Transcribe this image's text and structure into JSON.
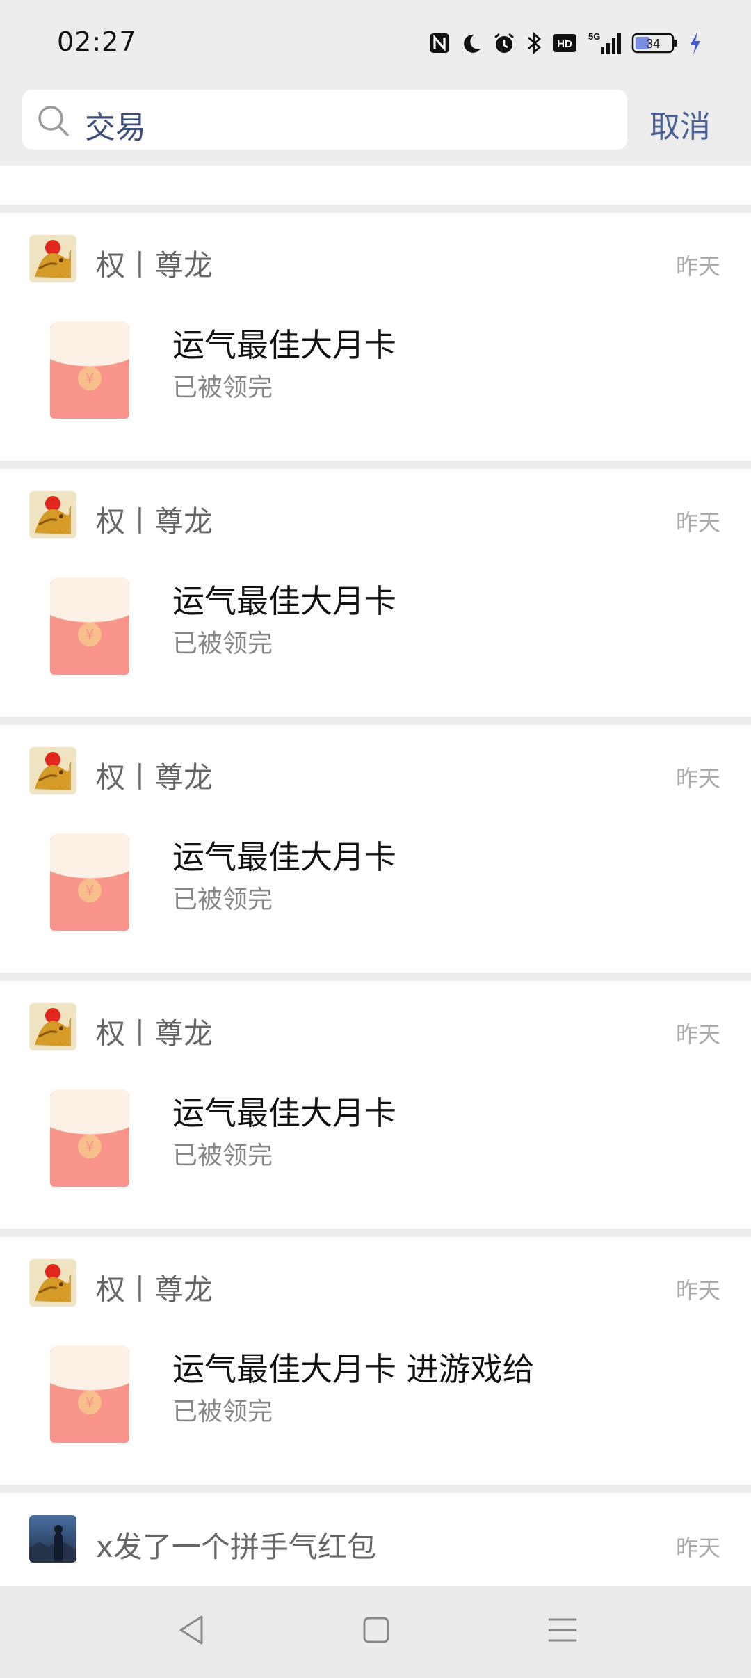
{
  "status": {
    "time": "02:27",
    "battery": "34",
    "icons": [
      "nfc-icon",
      "moon-icon",
      "alarm-icon",
      "bluetooth-icon",
      "hd-icon",
      "5g-signal-icon",
      "battery-icon",
      "charging-icon"
    ]
  },
  "search": {
    "query": "交易",
    "cancel_label": "取消"
  },
  "results": [
    {
      "sender": "权丨尊龙",
      "date": "昨天",
      "title": "运气最佳大月卡",
      "status": "已被领完"
    },
    {
      "sender": "权丨尊龙",
      "date": "昨天",
      "title": "运气最佳大月卡",
      "status": "已被领完"
    },
    {
      "sender": "权丨尊龙",
      "date": "昨天",
      "title": "运气最佳大月卡",
      "status": "已被领完"
    },
    {
      "sender": "权丨尊龙",
      "date": "昨天",
      "title": "运气最佳大月卡",
      "status": "已被领完"
    },
    {
      "sender": "权丨尊龙",
      "date": "昨天",
      "title": "运气最佳大月卡 进游戏给",
      "status": "已被领完"
    }
  ],
  "last_result": {
    "sender": "x发了一个拼手气红包",
    "date": "昨天"
  },
  "colors": {
    "background": "#ededed",
    "accent": "#4a6196",
    "envelope_body": "#f8958a",
    "envelope_flap": "#fdf1e6",
    "coin": "#f7c08a"
  }
}
